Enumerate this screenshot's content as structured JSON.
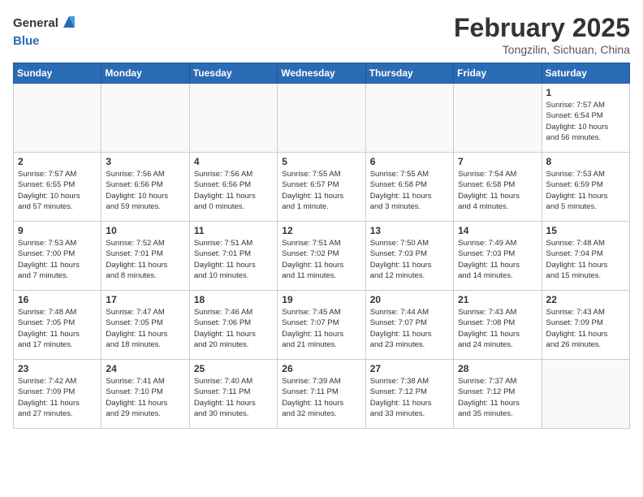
{
  "header": {
    "logo_line1": "General",
    "logo_line2": "Blue",
    "month_title": "February 2025",
    "location": "Tongzilin, Sichuan, China"
  },
  "weekdays": [
    "Sunday",
    "Monday",
    "Tuesday",
    "Wednesday",
    "Thursday",
    "Friday",
    "Saturday"
  ],
  "weeks": [
    [
      {
        "day": "",
        "info": ""
      },
      {
        "day": "",
        "info": ""
      },
      {
        "day": "",
        "info": ""
      },
      {
        "day": "",
        "info": ""
      },
      {
        "day": "",
        "info": ""
      },
      {
        "day": "",
        "info": ""
      },
      {
        "day": "1",
        "info": "Sunrise: 7:57 AM\nSunset: 6:54 PM\nDaylight: 10 hours\nand 56 minutes."
      }
    ],
    [
      {
        "day": "2",
        "info": "Sunrise: 7:57 AM\nSunset: 6:55 PM\nDaylight: 10 hours\nand 57 minutes."
      },
      {
        "day": "3",
        "info": "Sunrise: 7:56 AM\nSunset: 6:56 PM\nDaylight: 10 hours\nand 59 minutes."
      },
      {
        "day": "4",
        "info": "Sunrise: 7:56 AM\nSunset: 6:56 PM\nDaylight: 11 hours\nand 0 minutes."
      },
      {
        "day": "5",
        "info": "Sunrise: 7:55 AM\nSunset: 6:57 PM\nDaylight: 11 hours\nand 1 minute."
      },
      {
        "day": "6",
        "info": "Sunrise: 7:55 AM\nSunset: 6:58 PM\nDaylight: 11 hours\nand 3 minutes."
      },
      {
        "day": "7",
        "info": "Sunrise: 7:54 AM\nSunset: 6:58 PM\nDaylight: 11 hours\nand 4 minutes."
      },
      {
        "day": "8",
        "info": "Sunrise: 7:53 AM\nSunset: 6:59 PM\nDaylight: 11 hours\nand 5 minutes."
      }
    ],
    [
      {
        "day": "9",
        "info": "Sunrise: 7:53 AM\nSunset: 7:00 PM\nDaylight: 11 hours\nand 7 minutes."
      },
      {
        "day": "10",
        "info": "Sunrise: 7:52 AM\nSunset: 7:01 PM\nDaylight: 11 hours\nand 8 minutes."
      },
      {
        "day": "11",
        "info": "Sunrise: 7:51 AM\nSunset: 7:01 PM\nDaylight: 11 hours\nand 10 minutes."
      },
      {
        "day": "12",
        "info": "Sunrise: 7:51 AM\nSunset: 7:02 PM\nDaylight: 11 hours\nand 11 minutes."
      },
      {
        "day": "13",
        "info": "Sunrise: 7:50 AM\nSunset: 7:03 PM\nDaylight: 11 hours\nand 12 minutes."
      },
      {
        "day": "14",
        "info": "Sunrise: 7:49 AM\nSunset: 7:03 PM\nDaylight: 11 hours\nand 14 minutes."
      },
      {
        "day": "15",
        "info": "Sunrise: 7:48 AM\nSunset: 7:04 PM\nDaylight: 11 hours\nand 15 minutes."
      }
    ],
    [
      {
        "day": "16",
        "info": "Sunrise: 7:48 AM\nSunset: 7:05 PM\nDaylight: 11 hours\nand 17 minutes."
      },
      {
        "day": "17",
        "info": "Sunrise: 7:47 AM\nSunset: 7:05 PM\nDaylight: 11 hours\nand 18 minutes."
      },
      {
        "day": "18",
        "info": "Sunrise: 7:46 AM\nSunset: 7:06 PM\nDaylight: 11 hours\nand 20 minutes."
      },
      {
        "day": "19",
        "info": "Sunrise: 7:45 AM\nSunset: 7:07 PM\nDaylight: 11 hours\nand 21 minutes."
      },
      {
        "day": "20",
        "info": "Sunrise: 7:44 AM\nSunset: 7:07 PM\nDaylight: 11 hours\nand 23 minutes."
      },
      {
        "day": "21",
        "info": "Sunrise: 7:43 AM\nSunset: 7:08 PM\nDaylight: 11 hours\nand 24 minutes."
      },
      {
        "day": "22",
        "info": "Sunrise: 7:43 AM\nSunset: 7:09 PM\nDaylight: 11 hours\nand 26 minutes."
      }
    ],
    [
      {
        "day": "23",
        "info": "Sunrise: 7:42 AM\nSunset: 7:09 PM\nDaylight: 11 hours\nand 27 minutes."
      },
      {
        "day": "24",
        "info": "Sunrise: 7:41 AM\nSunset: 7:10 PM\nDaylight: 11 hours\nand 29 minutes."
      },
      {
        "day": "25",
        "info": "Sunrise: 7:40 AM\nSunset: 7:11 PM\nDaylight: 11 hours\nand 30 minutes."
      },
      {
        "day": "26",
        "info": "Sunrise: 7:39 AM\nSunset: 7:11 PM\nDaylight: 11 hours\nand 32 minutes."
      },
      {
        "day": "27",
        "info": "Sunrise: 7:38 AM\nSunset: 7:12 PM\nDaylight: 11 hours\nand 33 minutes."
      },
      {
        "day": "28",
        "info": "Sunrise: 7:37 AM\nSunset: 7:12 PM\nDaylight: 11 hours\nand 35 minutes."
      },
      {
        "day": "",
        "info": ""
      }
    ]
  ]
}
